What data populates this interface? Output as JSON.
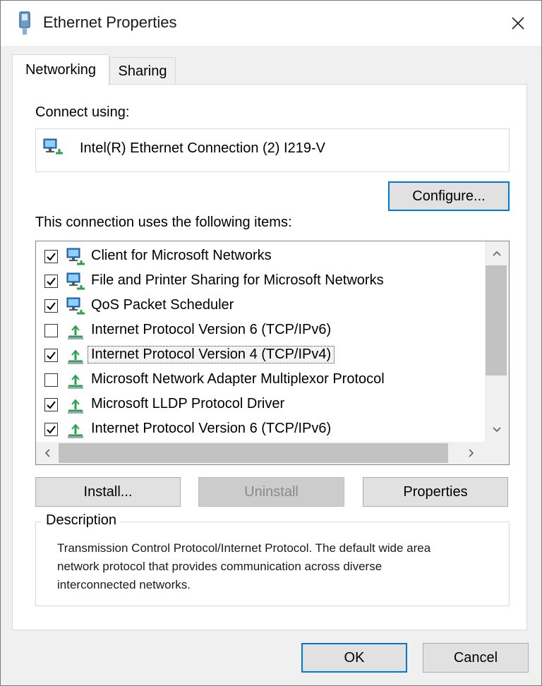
{
  "window": {
    "title": "Ethernet Properties"
  },
  "tabs": [
    {
      "label": "Networking",
      "active": true
    },
    {
      "label": "Sharing",
      "active": false
    }
  ],
  "connect_using": {
    "label": "Connect using:",
    "adapter": "Intel(R) Ethernet Connection (2) I219-V",
    "configure_label": "Configure..."
  },
  "items": {
    "label": "This connection uses the following items:",
    "list": [
      {
        "label": "Client for Microsoft Networks",
        "checked": true,
        "icon": "network-client-icon"
      },
      {
        "label": "File and Printer Sharing for Microsoft Networks",
        "checked": true,
        "icon": "network-service-icon"
      },
      {
        "label": "QoS Packet Scheduler",
        "checked": true,
        "icon": "network-service-icon"
      },
      {
        "label": "Internet Protocol Version 6 (TCP/IPv6)",
        "checked": false,
        "icon": "protocol-icon"
      },
      {
        "label": "Internet Protocol Version 4 (TCP/IPv4)",
        "checked": true,
        "icon": "protocol-icon",
        "selected": true
      },
      {
        "label": "Microsoft Network Adapter Multiplexor Protocol",
        "checked": false,
        "icon": "protocol-icon"
      },
      {
        "label": "Microsoft LLDP Protocol Driver",
        "checked": true,
        "icon": "protocol-icon"
      },
      {
        "label": "Internet Protocol Version 6 (TCP/IPv6)",
        "checked": true,
        "icon": "protocol-icon"
      }
    ]
  },
  "buttons": {
    "install": "Install...",
    "uninstall": "Uninstall",
    "properties": "Properties",
    "ok": "OK",
    "cancel": "Cancel"
  },
  "description": {
    "legend": "Description",
    "text": "Transmission Control Protocol/Internet Protocol. The default wide area network protocol that provides communication across diverse interconnected networks."
  },
  "colors": {
    "focus_border": "#0078d7",
    "dialog_bg": "#f0f0f0",
    "panel_bg": "#ffffff"
  }
}
